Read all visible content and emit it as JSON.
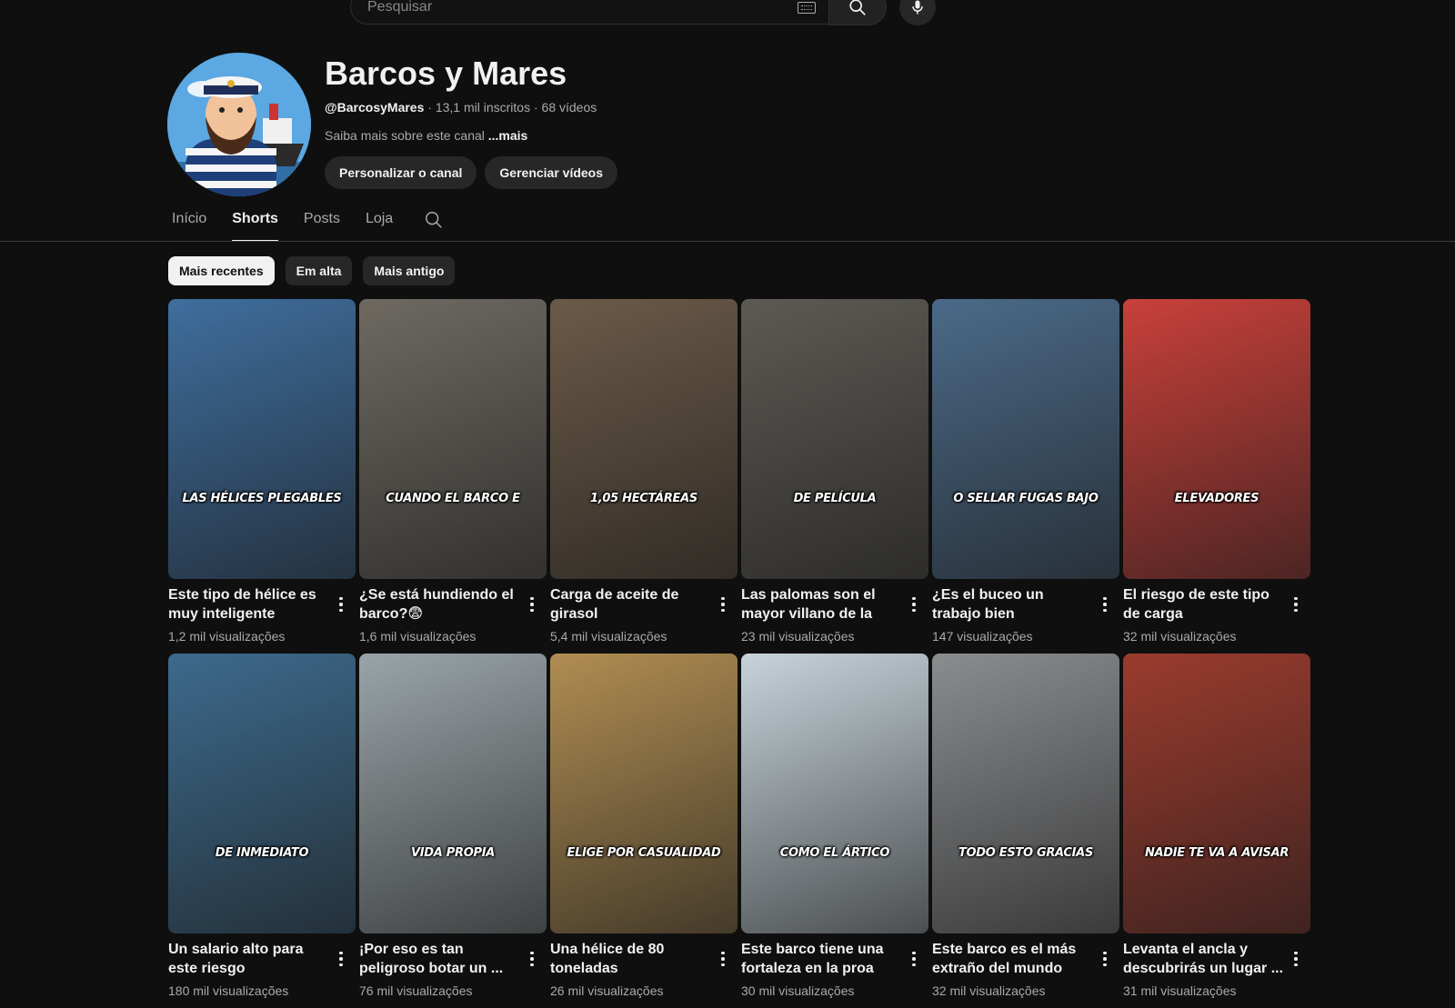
{
  "search": {
    "placeholder": "Pesquisar"
  },
  "channel": {
    "title": "Barcos y Mares",
    "handle": "@BarcosyMares",
    "subscribers": "13,1 mil inscritos",
    "videos": "68 vídeos",
    "separator": " · ",
    "about": "Saiba mais sobre este canal",
    "about_more": "...mais",
    "customize_label": "Personalizar o canal",
    "manage_label": "Gerenciar vídeos"
  },
  "tabs": [
    {
      "label": "Início"
    },
    {
      "label": "Shorts"
    },
    {
      "label": "Posts"
    },
    {
      "label": "Loja"
    }
  ],
  "chips": [
    {
      "label": "Mais recentes"
    },
    {
      "label": "Em alta"
    },
    {
      "label": "Mais antigo"
    }
  ],
  "shorts": [
    {
      "caption": "LAS HÉLICES PLEGABLES",
      "title": "Este tipo de hélice es muy inteligente",
      "views": "1,2 mil visualizações"
    },
    {
      "caption": "CUANDO EL BARCO E",
      "title": "¿Se está hundiendo el barco?😨",
      "views": "1,6 mil visualizações"
    },
    {
      "caption": "1,05 HECTÁREAS",
      "title": "Carga de aceite de girasol",
      "views": "5,4 mil visualizações"
    },
    {
      "caption": "DE PELÍCULA",
      "title": "Las palomas son el mayor villano de la soja",
      "views": "23 mil visualizações"
    },
    {
      "caption": "O SELLAR FUGAS BAJO",
      "title": "¿Es el buceo un trabajo bien remunerado?",
      "views": "147 visualizações"
    },
    {
      "caption": "ELEVADORES",
      "title": "El riesgo de este tipo de carga",
      "views": "32 mil visualizações"
    },
    {
      "caption": "DE INMEDIATO",
      "title": "Un salario alto para este riesgo",
      "views": "180 mil visualizações"
    },
    {
      "caption": "VIDA PROPIA",
      "title": "¡Por eso es tan peligroso botar un ...",
      "views": "76 mil visualizações"
    },
    {
      "caption": "ELIGE POR CASUALIDAD",
      "title": "Una hélice de 80 toneladas",
      "views": "26 mil visualizações"
    },
    {
      "caption": "COMO EL ÁRTICO",
      "title": "Este barco tiene una fortaleza en la proa",
      "views": "30 mil visualizações"
    },
    {
      "caption": "TODO ESTO GRACIAS",
      "title": "Este barco es el más extraño del mundo",
      "views": "32 mil visualizações"
    },
    {
      "caption": "NADIE TE VA A AVISAR",
      "title": "Levanta el ancla y descubrirás un lugar ...",
      "views": "31 mil visualizações"
    }
  ],
  "thumbnail_colors": [
    "#3f6e9e",
    "#6e6a62",
    "#6b5a48",
    "#5d5a54",
    "#4b6a88",
    "#c9403a",
    "#3d6a8c",
    "#9aa4a8",
    "#b08d52",
    "#c7d3da",
    "#8a8c8e",
    "#9b3b2e"
  ]
}
